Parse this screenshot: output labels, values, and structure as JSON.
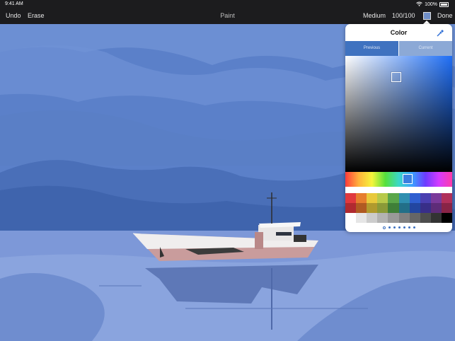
{
  "status": {
    "time": "9:41 AM",
    "battery": "100%"
  },
  "toolbar": {
    "undo": "Undo",
    "erase": "Erase",
    "title": "Paint",
    "brush_size": "Medium",
    "opacity": "100/100",
    "done": "Done",
    "current_color": "#6f8ec7"
  },
  "color_popover": {
    "title": "Color",
    "tabs": {
      "previous": "Previous",
      "current": "Current"
    },
    "selected_hue": "#1f6ef5",
    "swatches": [
      [
        "#e0393e",
        "#e67e2e",
        "#e8c93b",
        "#b7c94a",
        "#5aa64a",
        "#2f8fb0",
        "#2f5fd0",
        "#4a3fb0",
        "#7a3a9a",
        "#b0305a"
      ],
      [
        "#b02a30",
        "#b05a22",
        "#b09a2e",
        "#8a9a38",
        "#3f7f38",
        "#226f88",
        "#2246a0",
        "#382e88",
        "#5e2c78",
        "#882446"
      ],
      [
        "#ffffff",
        "#e6e6e6",
        "#cccccc",
        "#b3b3b3",
        "#999999",
        "#808080",
        "#666666",
        "#4d4d4d",
        "#333333",
        "#000000"
      ]
    ],
    "page_dots": 7
  }
}
